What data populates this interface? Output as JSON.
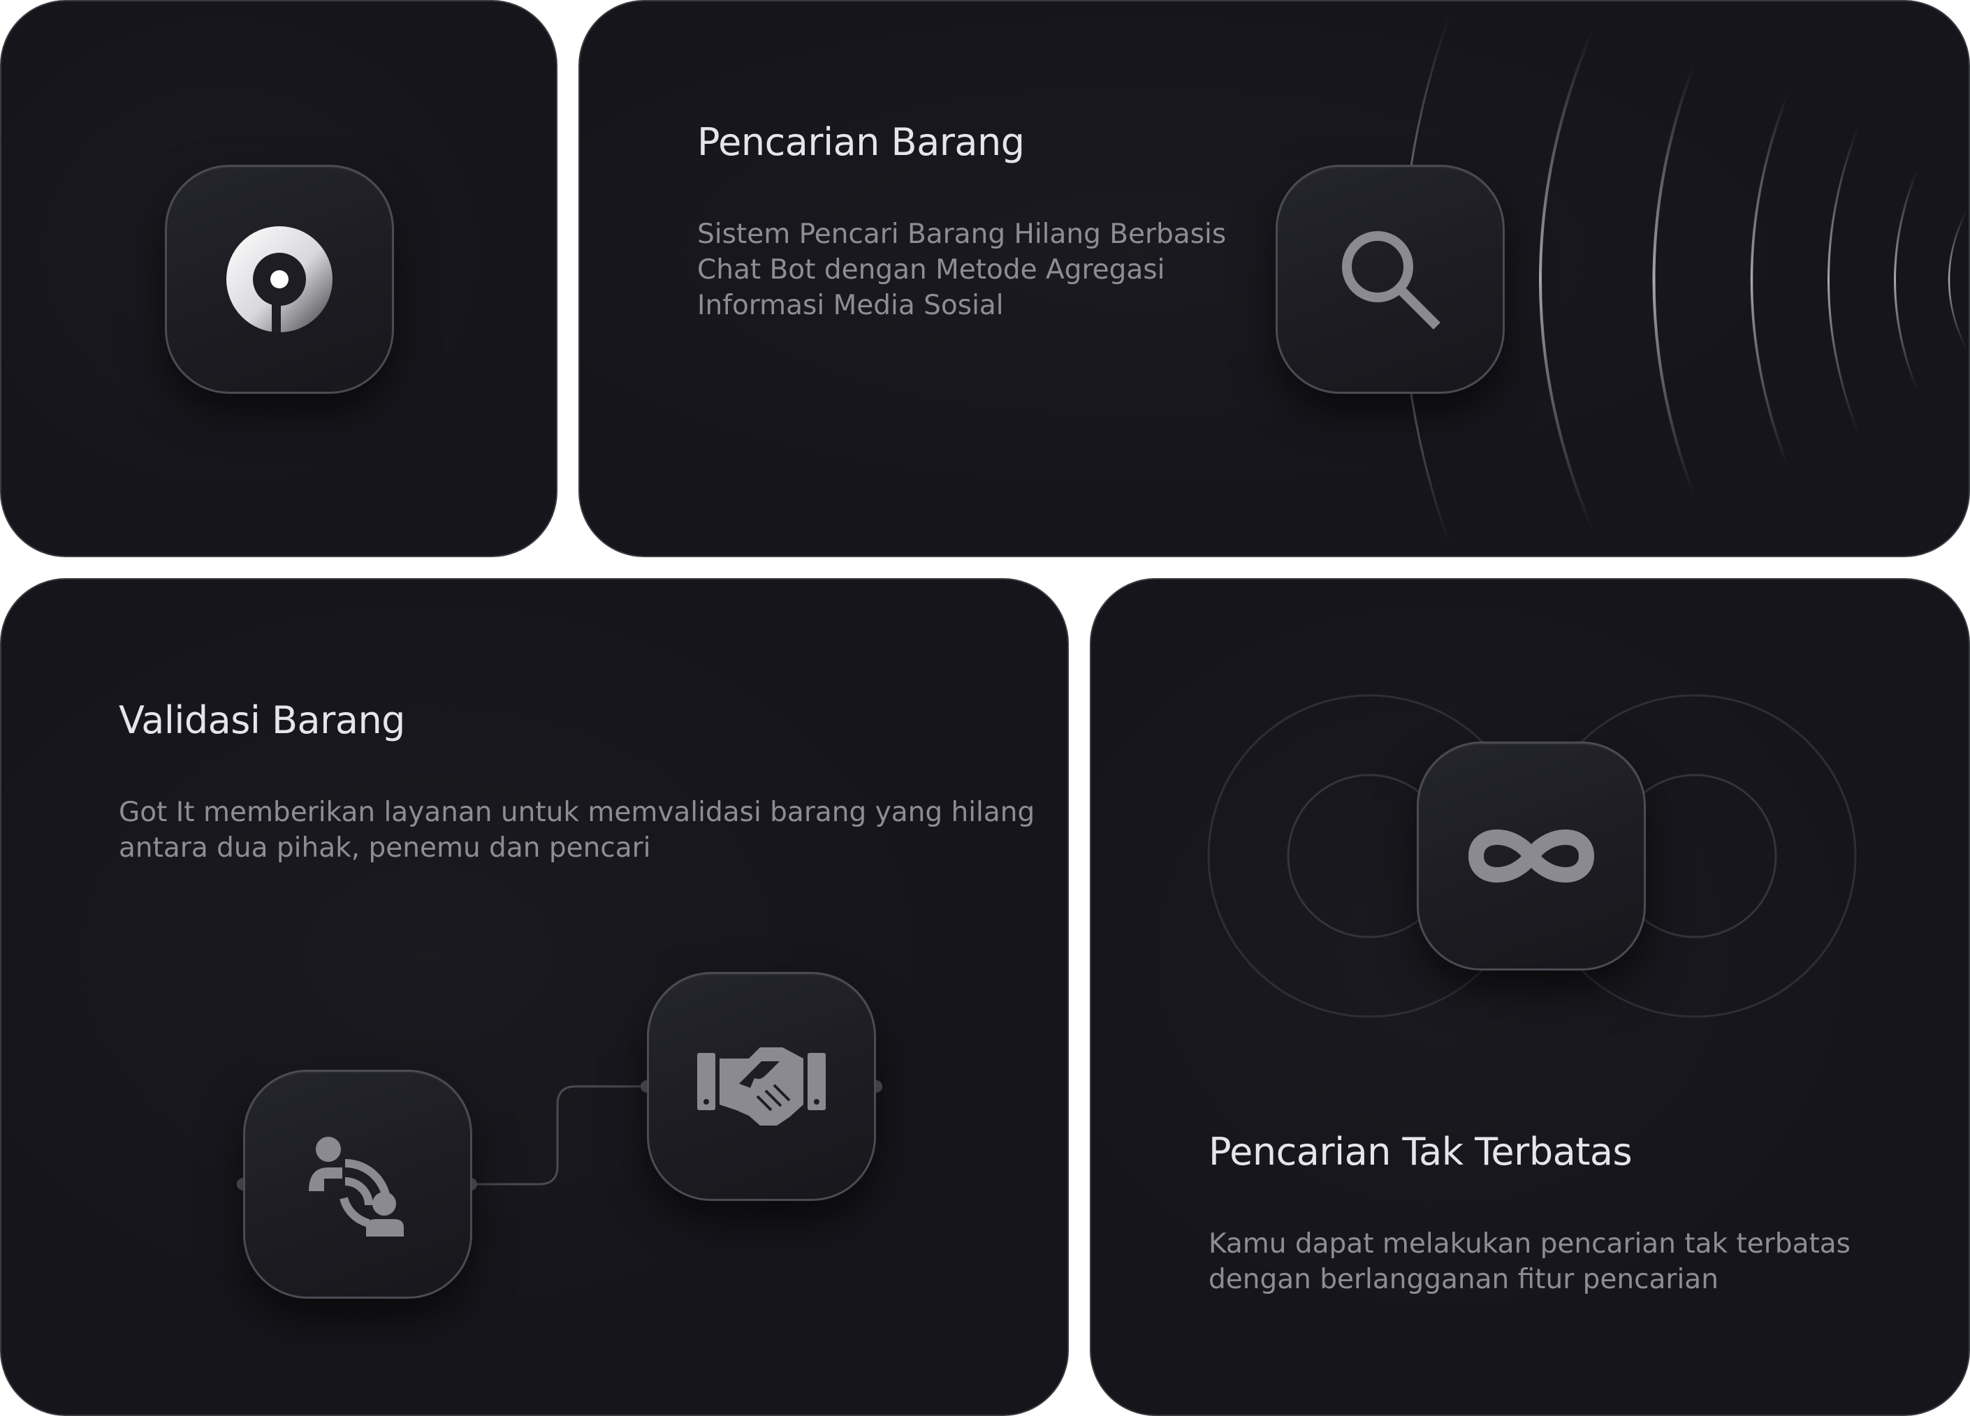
{
  "cards": {
    "logo": {
      "icon": "logo-icon"
    },
    "search": {
      "title": "Pencarian Barang",
      "description_lines": [
        "Sistem Pencari Barang Hilang Berbasis",
        "Chat Bot dengan Metode Agregasi",
        "Informasi Media Sosial"
      ],
      "icon": "search-icon"
    },
    "validation": {
      "title": "Validasi Barang",
      "description_lines": [
        "Got It memberikan layanan untuk memvalidasi barang yang hilang",
        "antara dua pihak, penemu dan pencari"
      ],
      "icons": [
        "users-contact-icon",
        "handshake-icon"
      ]
    },
    "unlimited": {
      "title": "Pencarian Tak Terbatas",
      "description_lines": [
        "Kamu dapat melakukan pencarian tak terbatas",
        "dengan berlangganan fitur pencarian"
      ],
      "icon": "infinity-icon"
    }
  },
  "colors": {
    "card_background": "#15151b",
    "card_border": "#3a3a42",
    "title_text": "#e6e6ea",
    "body_text": "#8d8d96",
    "icon_gray": "#8a8a90"
  }
}
